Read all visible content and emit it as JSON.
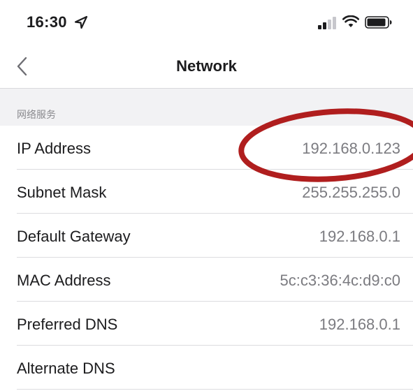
{
  "status_bar": {
    "time": "16:30",
    "icons": [
      "location-arrow-icon",
      "cellular-signal-icon",
      "wifi-icon",
      "battery-icon"
    ]
  },
  "nav": {
    "back_icon": "chevron-left-icon",
    "title": "Network"
  },
  "section": {
    "label": "网络服务"
  },
  "rows": [
    {
      "label": "IP Address",
      "value": "192.168.0.123"
    },
    {
      "label": "Subnet Mask",
      "value": "255.255.255.0"
    },
    {
      "label": "Default Gateway",
      "value": "192.168.0.1"
    },
    {
      "label": "MAC Address",
      "value": "5c:c3:36:4c:d9:c0"
    },
    {
      "label": "Preferred DNS",
      "value": "192.168.0.1"
    },
    {
      "label": "Alternate DNS",
      "value": ""
    }
  ],
  "colors": {
    "annotation": "#b01e1e",
    "text_primary": "#1c1c1e",
    "text_secondary": "#7b7b80",
    "section_bg": "#f2f2f4"
  }
}
